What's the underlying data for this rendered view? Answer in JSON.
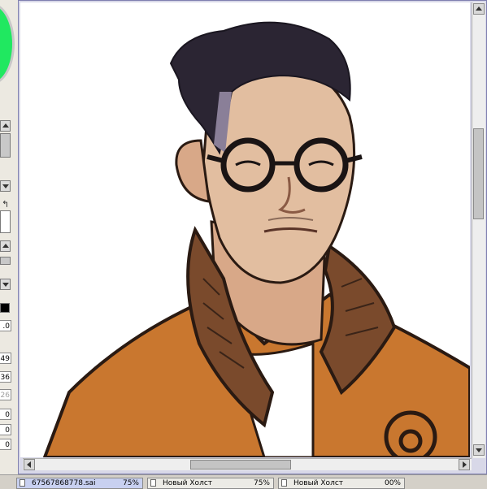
{
  "left_panel": {
    "numbers": [
      ".0",
      "49",
      "36",
      "26",
      "0",
      "0",
      "0"
    ],
    "primary_color": "#000000",
    "wheel_color": "#20e860",
    "swap_icon": "swap-colors-icon"
  },
  "tabs": [
    {
      "name": "67567868778.sai",
      "zoom": "75%",
      "active": true
    },
    {
      "name": "Новый Холст",
      "zoom": "75%",
      "active": false
    },
    {
      "name": "Новый Холст",
      "zoom": "00%",
      "active": false
    }
  ],
  "colors": {
    "hair": "#2b2533",
    "skin": "#e2bea0",
    "jacket": "#c9772f",
    "collar": "#7a4a2c",
    "shirt": "#ffffff"
  }
}
